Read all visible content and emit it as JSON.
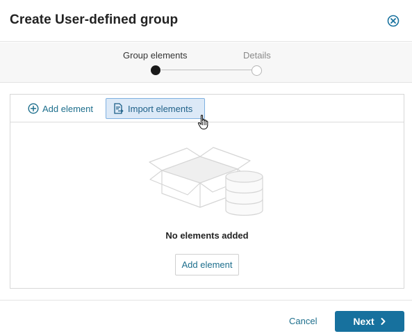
{
  "dialog": {
    "title": "Create User-defined group"
  },
  "stepper": {
    "steps": [
      {
        "label": "Group elements",
        "state": "active"
      },
      {
        "label": "Details",
        "state": "inactive"
      }
    ]
  },
  "toolbar": {
    "add_label": "Add element",
    "import_label": "Import elements"
  },
  "empty_state": {
    "message": "No elements added",
    "add_button_label": "Add element"
  },
  "footer": {
    "cancel_label": "Cancel",
    "next_label": "Next"
  },
  "colors": {
    "accent": "#17719e",
    "link": "#1c6e8c",
    "import_highlight": "#dce9f7"
  },
  "icons": {
    "close": "close-circle-icon",
    "add": "plus-circle-icon",
    "import": "import-document-icon",
    "next": "chevron-right-icon",
    "cursor": "hand-pointer-icon",
    "illustration": "empty-box-database-icon"
  }
}
